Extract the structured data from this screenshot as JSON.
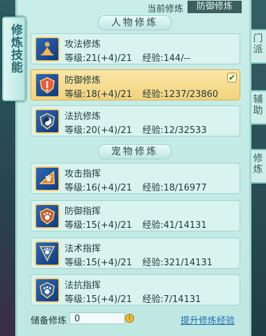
{
  "side_tab": {
    "label": "修炼技能"
  },
  "right_tabs": [
    "门派",
    "辅助",
    "修炼"
  ],
  "current": {
    "label": "当前修炼",
    "value": "防御修炼"
  },
  "sections": {
    "character": "人物修炼",
    "pet": "宠物修炼"
  },
  "items": [
    {
      "name": "攻法修炼",
      "level": "等级:21(+4)/21",
      "exp": "经验:144/--",
      "selected": false,
      "icon": "meditating-figure-icon"
    },
    {
      "name": "防御修炼",
      "level": "等级:18(+4)/21",
      "exp": "经验:1237/23860",
      "selected": true,
      "icon": "shield-emblem-icon"
    },
    {
      "name": "法抗修炼",
      "level": "等级:20(+4)/21",
      "exp": "经验:12/32533",
      "selected": false,
      "icon": "yin-yang-shield-icon"
    },
    {
      "name": "攻击指挥",
      "level": "等级:16(+4)/21",
      "exp": "经验:18/16977",
      "selected": false,
      "icon": "paw-attack-icon"
    },
    {
      "name": "防御指挥",
      "level": "等级:15(+4)/21",
      "exp": "经验:41/14131",
      "selected": false,
      "icon": "paw-shield-icon"
    },
    {
      "name": "法术指挥",
      "level": "等级:15(+4)/21",
      "exp": "经验:321/14131",
      "selected": false,
      "icon": "paw-magic-icon"
    },
    {
      "name": "法抗指挥",
      "level": "等级:15(+4)/21",
      "exp": "经验:7/14131",
      "selected": false,
      "icon": "paw-resist-icon"
    }
  ],
  "footer": {
    "reserve_label": "储备修炼",
    "reserve_value": "0",
    "coin_glyph": "i",
    "upgrade_link": "提升修炼经验"
  },
  "check_glyph": "✔"
}
